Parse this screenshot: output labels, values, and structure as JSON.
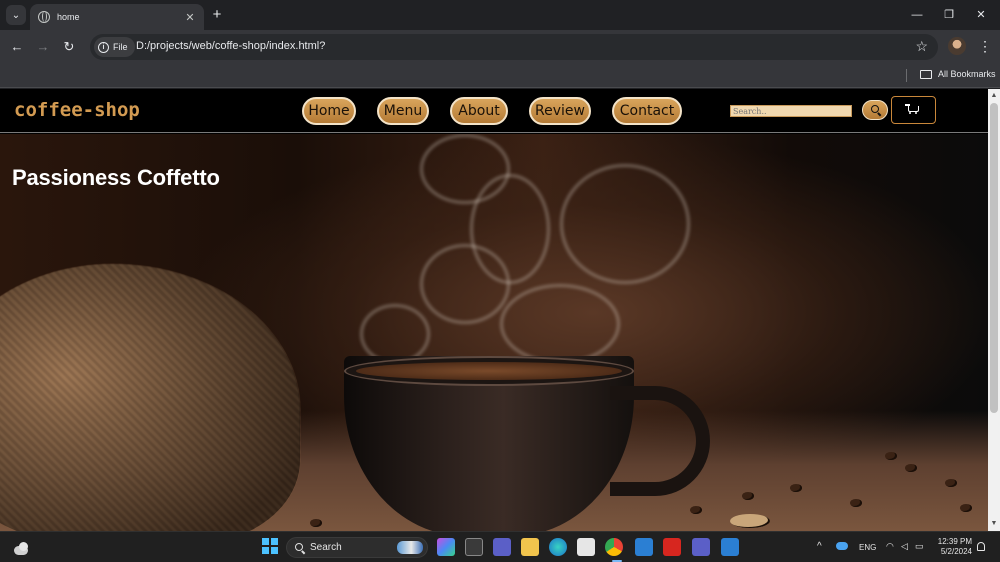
{
  "browser": {
    "tab_title": "home",
    "tab_close": "✕",
    "new_tab": "+",
    "site_info_label": "File",
    "url": "D:/projects/web/coffe-shop/index.html?",
    "all_bookmarks": "All Bookmarks",
    "window_controls": {
      "minimize": "—",
      "restore": "❐",
      "close": "✕"
    },
    "nav": {
      "back": "←",
      "forward": "→",
      "reload": "↻"
    }
  },
  "site": {
    "logo": "coffee-shop",
    "nav": [
      "Home",
      "Menu",
      "About",
      "Review",
      "Contact"
    ],
    "search_placeholder": "Search..",
    "accent_color": "#d39b52",
    "hero_title": "Passioness Coffetto"
  },
  "taskbar": {
    "search_label": "Search",
    "language": "ENG",
    "time": "12:39 PM",
    "date": "5/2/2024",
    "chevron": "^"
  }
}
